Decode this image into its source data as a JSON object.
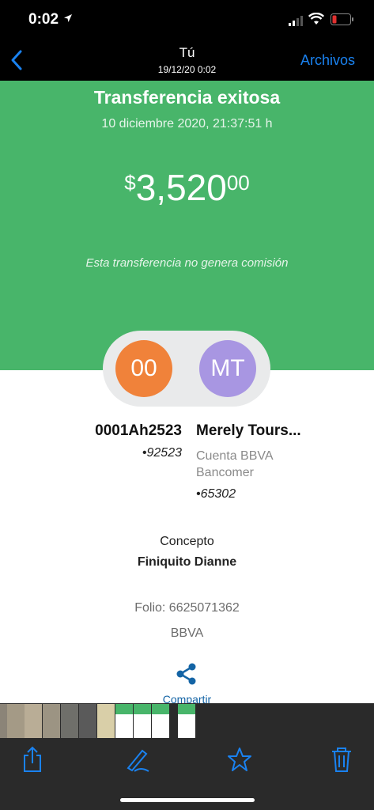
{
  "status_bar": {
    "time": "0:02"
  },
  "nav": {
    "title": "Tú",
    "subtitle": "19/12/20 0:02",
    "archive_label": "Archivos"
  },
  "receipt": {
    "title": "Transferencia exitosa",
    "date": "10 diciembre 2020, 21:37:51 h",
    "amount_currency": "$",
    "amount_integer": "3,520",
    "amount_decimals": "00",
    "note": "Esta transferencia no genera comisión",
    "sender": {
      "initials": "00",
      "name": "0001Ah2523",
      "account": "•92523"
    },
    "recipient": {
      "initials": "MT",
      "name": "Merely Tours...",
      "bank_line1": "Cuenta BBVA",
      "bank_line2": "Bancomer",
      "account": "•65302"
    },
    "concepto_label": "Concepto",
    "concepto_value": "Finiquito  Dianne",
    "folio": "Folio: 6625071362",
    "bank": "BBVA",
    "share_label": "Compartir"
  },
  "colors": {
    "success_green": "#48b56a",
    "sender_avatar": "#f0823a",
    "recipient_avatar": "#a896e2",
    "ios_blue": "#1a82f0"
  },
  "toolbar_icons": [
    "share-icon",
    "markup-icon",
    "favorite-icon",
    "trash-icon"
  ]
}
